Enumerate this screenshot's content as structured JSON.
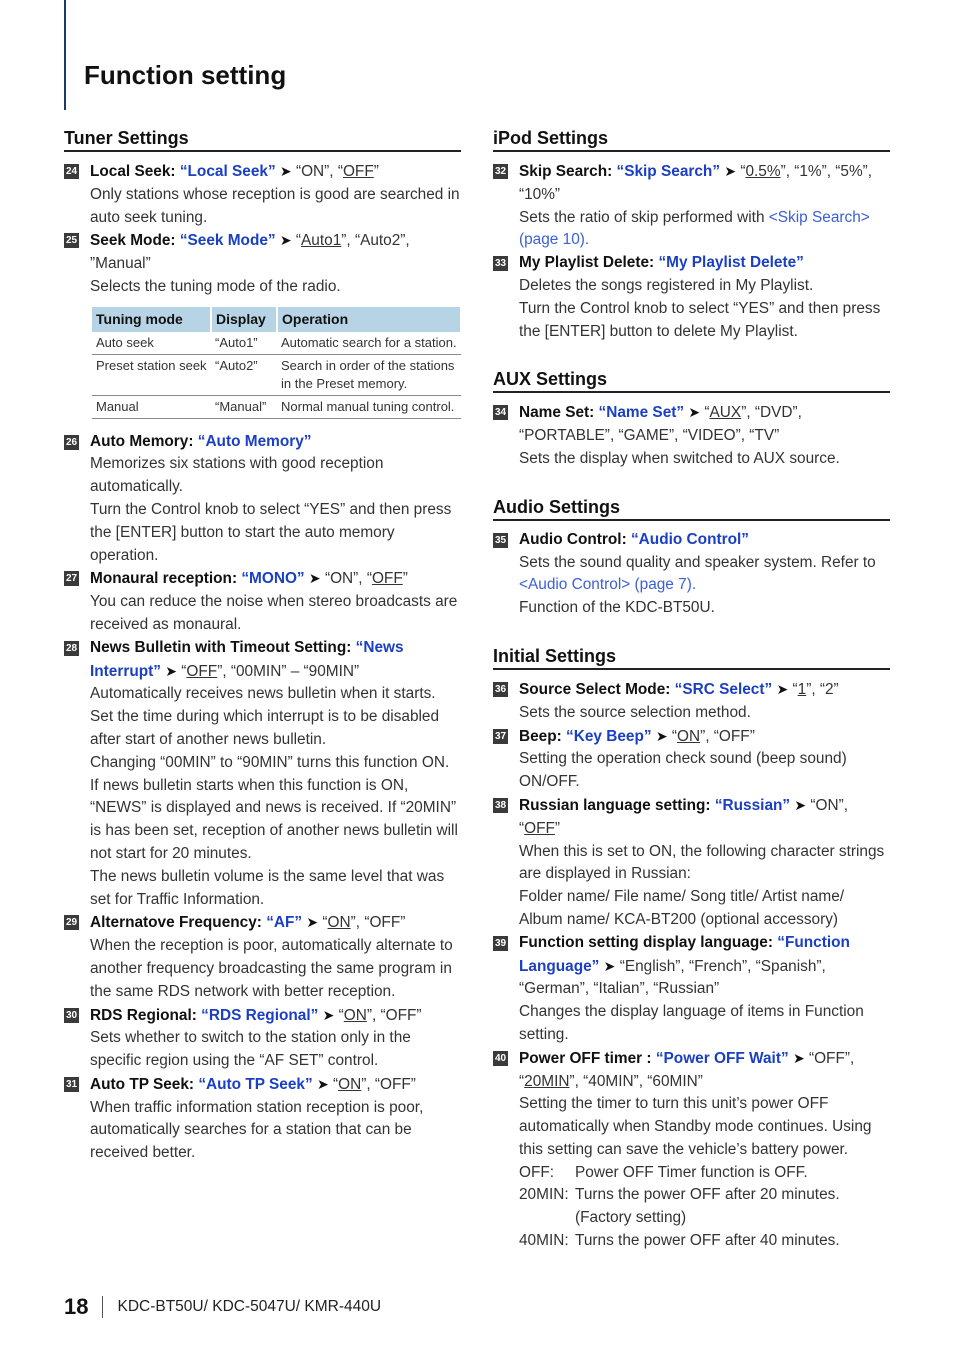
{
  "page_title": "Function setting",
  "footer": {
    "page_number": "18",
    "models": "KDC-BT50U/ KDC-5047U/ KMR-440U"
  },
  "arrow": "➤",
  "tuner": {
    "heading": "Tuner Settings",
    "items": [
      {
        "num": "24",
        "label": "Local Seek: ",
        "kw": "“Local Seek”",
        "opts_pre": "“ON”, “",
        "opts_u": "OFF",
        "opts_post": "”",
        "desc": "Only stations whose reception is good are searched in auto seek tuning."
      },
      {
        "num": "25",
        "label": "Seek Mode: ",
        "kw": "“Seek Mode”",
        "opts_pre": "“",
        "opts_u": "Auto1",
        "opts_post": "”, “Auto2”, ”Manual”",
        "desc": "Selects the tuning mode of the radio."
      }
    ],
    "table": {
      "headers": [
        "Tuning mode",
        "Display",
        "Operation"
      ],
      "rows": [
        [
          "Auto seek",
          "“Auto1”",
          "Automatic search for a station."
        ],
        [
          "Preset station seek",
          "“Auto2”",
          "Search in order of the stations in the Preset memory."
        ],
        [
          "Manual",
          "“Manual”",
          "Normal manual tuning control."
        ]
      ]
    },
    "items2": [
      {
        "num": "26",
        "label": "Auto Memory: ",
        "kw": "“Auto Memory”",
        "desc": "Memorizes six stations with good reception automatically.",
        "desc2": "Turn the Control knob to select “YES” and then press the [ENTER] button to start the auto memory operation."
      },
      {
        "num": "27",
        "label": "Monaural reception: ",
        "kw": "“MONO”",
        "opts_pre": "“ON”, “",
        "opts_u": "OFF",
        "opts_post": "”",
        "desc": "You can reduce the noise when stereo broadcasts are received as monaural."
      },
      {
        "num": "28",
        "label": "News Bulletin with Timeout Setting: ",
        "kw": "“News Interrupt”",
        "opts_pre": "“",
        "opts_u": "OFF",
        "opts_post": "”, “00MIN” – “90MIN”",
        "desc": "Automatically receives news bulletin when it starts. Set the time during which interrupt is to be disabled after start of another news bulletin.",
        "desc2": "Changing “00MIN” to “90MIN” turns this function ON.",
        "desc3": "If news bulletin starts when this function is ON, “NEWS” is displayed and news is received. If “20MIN” is has been set, reception of another news bulletin will not start for 20 minutes.",
        "desc4": "The news bulletin volume is the same level that was set for Traffic Information."
      },
      {
        "num": "29",
        "label": "Alternatove Frequency: ",
        "kw": "“AF”",
        "opts_pre": "“",
        "opts_u": "ON",
        "opts_post": "”, “OFF”",
        "desc": "When the reception is poor, automatically alternate to another frequency broadcasting the same program in the same RDS network with better reception."
      },
      {
        "num": "30",
        "label": "RDS Regional: ",
        "kw": "“RDS Regional”",
        "opts_pre": "“",
        "opts_u": "ON",
        "opts_post": "”, “OFF”",
        "desc": "Sets whether to switch to the station only in the specific region using the “AF SET” control."
      },
      {
        "num": "31",
        "label": "Auto TP Seek: ",
        "kw": "“Auto TP Seek”",
        "opts_pre": "“",
        "opts_u": "ON",
        "opts_post": "”, “OFF”",
        "desc": "When traffic information station reception is poor, automatically searches for a station that can be received better."
      }
    ]
  },
  "ipod": {
    "heading": "iPod Settings",
    "items": [
      {
        "num": "32",
        "label": "Skip Search: ",
        "kw": "“Skip Search”",
        "opts_pre": "“",
        "opts_u": "0.5%",
        "opts_post": "”, “1%”, “5%”, “10%”",
        "desc": "Sets the ratio of skip performed with ",
        "link": "<Skip Search> (page 10)."
      },
      {
        "num": "33",
        "label": "My Playlist Delete: ",
        "kw": "“My Playlist Delete”",
        "desc": "Deletes the songs registered in My Playlist.",
        "desc2": "Turn the Control knob to select “YES” and then press the [ENTER] button to delete My Playlist."
      }
    ]
  },
  "aux": {
    "heading": "AUX Settings",
    "items": [
      {
        "num": "34",
        "label": "Name Set: ",
        "kw": "“Name Set”",
        "opts_pre": "“",
        "opts_u": "AUX",
        "opts_post": "”, “DVD”, “PORTABLE”, “GAME”, “VIDEO”, “TV”",
        "desc": "Sets the display when switched to AUX source."
      }
    ]
  },
  "audio": {
    "heading": "Audio Settings",
    "items": [
      {
        "num": "35",
        "label": "Audio Control: ",
        "kw": "“Audio Control”",
        "desc": "Sets the sound quality and speaker system. Refer to ",
        "link": "<Audio Control> (page 7).",
        "desc2": "Function of the KDC-BT50U."
      }
    ]
  },
  "initial": {
    "heading": "Initial Settings",
    "items": [
      {
        "num": "36",
        "label": "Source Select Mode: ",
        "kw": "“SRC Select”",
        "opts_pre": "“",
        "opts_u": "1",
        "opts_post": "”, “2”",
        "desc": "Sets the source selection method."
      },
      {
        "num": "37",
        "label": "Beep: ",
        "kw": "“Key Beep”",
        "opts_pre": "“",
        "opts_u": "ON",
        "opts_post": "”, “OFF”",
        "desc": "Setting the operation check sound (beep sound) ON/OFF."
      },
      {
        "num": "38",
        "label": "Russian language setting: ",
        "kw": "“Russian”",
        "opts_pre": "“ON”, “",
        "opts_u": "OFF",
        "opts_post": "”",
        "desc": "When this is set to ON, the following character strings are displayed in Russian:",
        "desc2": "Folder name/ File name/ Song title/ Artist name/ Album name/ KCA-BT200 (optional accessory)"
      },
      {
        "num": "39",
        "label": "Function setting display language: ",
        "kw": "“Function Language”",
        "opts_pre": "“English”, “French”, “Spanish”, “German”, “Italian”, “Russian”",
        "desc": "Changes the display language of items in Function setting."
      },
      {
        "num": "40",
        "label": "Power OFF timer : ",
        "kw": "“Power OFF Wait”",
        "opts_pre": "“OFF”, “",
        "opts_u": "20MIN",
        "opts_post": "”, “40MIN”, “60MIN”",
        "desc": "Setting the timer to turn this unit’s power OFF automatically when Standby mode continues. Using this setting can save the vehicle’s battery power.",
        "options": [
          {
            "k": "OFF:",
            "v": "Power OFF Timer function is OFF."
          },
          {
            "k": "20MIN:",
            "v": "Turns the power OFF after 20 minutes. (Factory setting)"
          },
          {
            "k": "40MIN:",
            "v": "Turns the power OFF after 40 minutes."
          }
        ]
      }
    ]
  }
}
